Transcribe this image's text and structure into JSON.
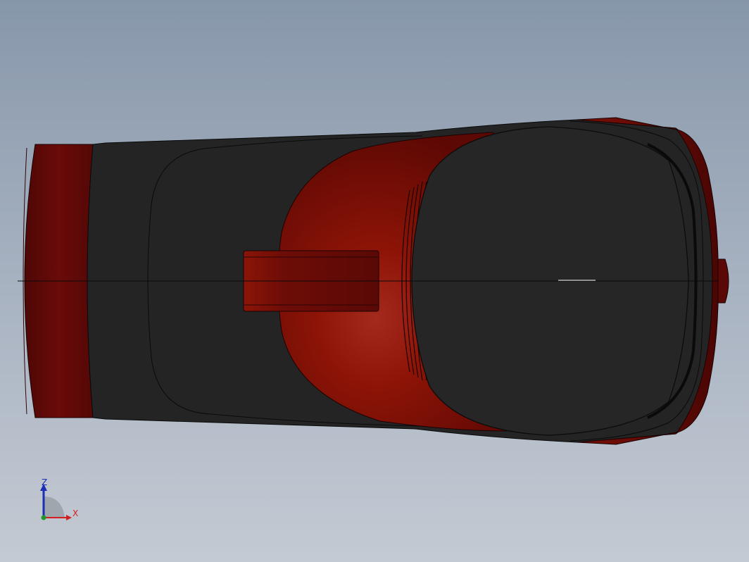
{
  "viewport": {
    "background_top": "#8797aa",
    "background_bottom": "#c4cad3"
  },
  "model": {
    "body_color": "#232323",
    "accent_color": "#8e1406",
    "accent_dark": "#5b0d07",
    "edge_color": "#000000"
  },
  "triad": {
    "z_label": "Z",
    "x_label": "X",
    "z_color": "#1b2fb5",
    "x_color": "#d11f1f",
    "origin_color": "#1c9a2e"
  }
}
